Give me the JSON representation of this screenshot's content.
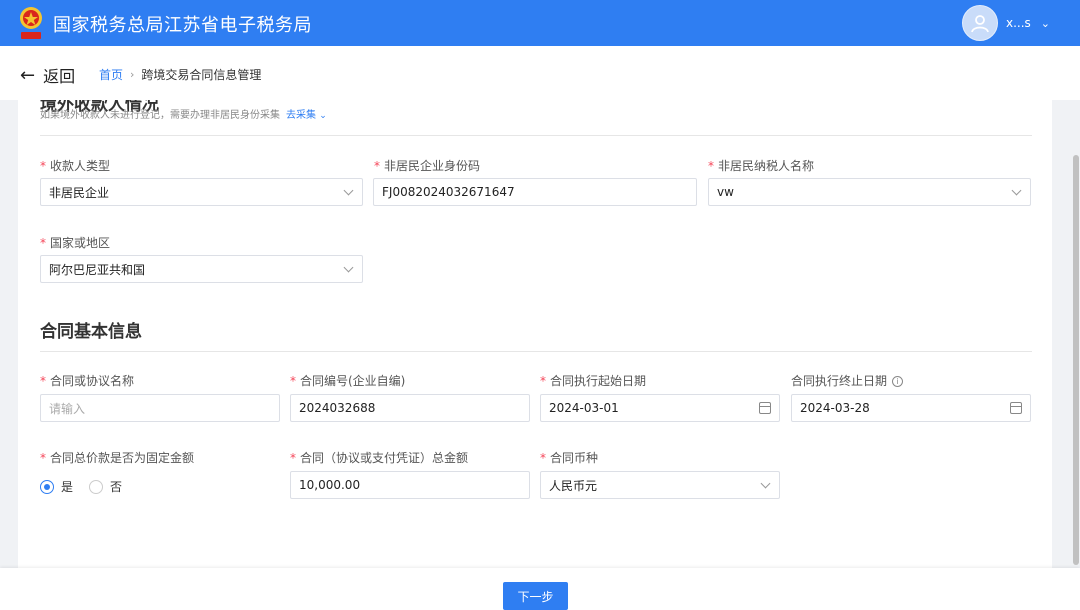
{
  "header": {
    "site_title": "国家税务总局江苏省电子税务局",
    "user_name": "x...s"
  },
  "nav": {
    "back_label": "返回",
    "breadcrumb_home": "首页",
    "breadcrumb_current": "跨境交易合同信息管理"
  },
  "payee": {
    "section_title": "境外收款人情况",
    "hint": "如果境外收款人未进行登记，需要办理非居民身份采集",
    "hint_link": "去采集",
    "fields": {
      "payee_type_label": "收款人类型",
      "payee_type_value": "非居民企业",
      "id_code_label": "非居民企业身份码",
      "id_code_value": "FJ0082024032671647",
      "taxpayer_name_label": "非居民纳税人名称",
      "taxpayer_name_value": "vw",
      "country_label": "国家或地区",
      "country_value": "阿尔巴尼亚共和国"
    }
  },
  "contract": {
    "section_title": "合同基本信息",
    "fields": {
      "name_label": "合同或协议名称",
      "name_placeholder": "请输入",
      "number_label": "合同编号(企业自编)",
      "number_value": "2024032688",
      "start_label": "合同执行起始日期",
      "start_value": "2024-03-01",
      "end_label": "合同执行终止日期",
      "end_value": "2024-03-28",
      "fixed_label": "合同总价款是否为固定金额",
      "fixed_yes": "是",
      "fixed_no": "否",
      "fixed_selected": "是",
      "amount_label": "合同（协议或支付凭证）总金额",
      "amount_value": "10,000.00",
      "currency_label": "合同币种",
      "currency_value": "人民币元"
    }
  },
  "footer": {
    "next_label": "下一步"
  },
  "colors": {
    "primary": "#2f7ef2",
    "required": "#f5475a"
  }
}
